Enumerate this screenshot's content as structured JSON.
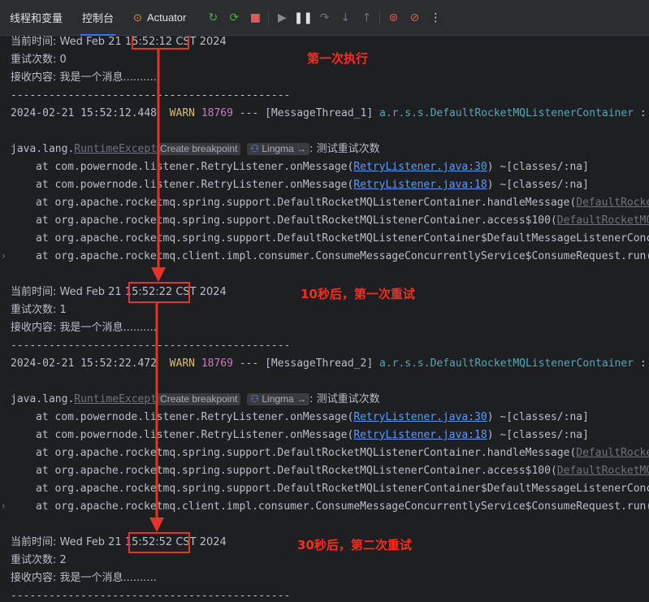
{
  "toolbar": {
    "tabs": [
      "线程和变量",
      "控制台",
      "Actuator"
    ],
    "more": "⋮"
  },
  "blocks": [
    {
      "time_prefix": "当前时间: Wed Feb 21 ",
      "time": "15:52:12",
      "time_suffix": " CST 2024",
      "retry": "重试次数: 0",
      "content": "接收内容: 我是一个消息..........",
      "divider": "--------------------------------------------",
      "log_ts": "2024-02-21 15:52:12.448",
      "log_level": "WARN",
      "log_pid": "18769",
      "log_thread": " --- [MessageThread_1] ",
      "log_class": "a.r.s.s.DefaultRocketMQListenerContainer",
      "log_tail": " :",
      "annotation": "第一次执行"
    },
    {
      "time_prefix": "当前时间: Wed Feb 21 ",
      "time": "15:52:22",
      "time_suffix": " CST 2024",
      "retry": "重试次数: 1",
      "content": "接收内容: 我是一个消息..........",
      "divider": "--------------------------------------------",
      "log_ts": "2024-02-21 15:52:22.472",
      "log_level": "WARN",
      "log_pid": "18769",
      "log_thread": " --- [MessageThread_2] ",
      "log_class": "a.r.s.s.DefaultRocketMQListenerContainer",
      "log_tail": " :",
      "annotation": "10秒后，第一次重试"
    },
    {
      "time_prefix": "当前时间: Wed Feb 21 ",
      "time": "15:52:52",
      "time_suffix": " CST 2024",
      "retry": "重试次数: 2",
      "content": "接收内容: 我是一个消息..........",
      "divider": "--------------------------------------------",
      "annotation": "30秒后，第二次重试"
    }
  ],
  "exception": {
    "prefix": "java.lang.",
    "name": "RuntimeExcept",
    "create_breakpoint": "Create breakpoint",
    "lingma": "Lingma",
    "message": ": 测试重试次数",
    "stack": [
      {
        "text": "at com.powernode.listener.RetryListener.onMessage(",
        "link": "RetryListener.java:30",
        "tail": ") ~[classes/:na]",
        "gray": false
      },
      {
        "text": "at com.powernode.listener.RetryListener.onMessage(",
        "link": "RetryListener.java:18",
        "tail": ") ~[classes/:na]",
        "gray": false
      },
      {
        "text": "at org.apache.rocketmq.spring.support.DefaultRocketMQListenerContainer.handleMessage(",
        "link": "DefaultRocke",
        "tail": "",
        "gray": true
      },
      {
        "text": "at org.apache.rocketmq.spring.support.DefaultRocketMQListenerContainer.access$100(",
        "link": "DefaultRocketMQ",
        "tail": "",
        "gray": true
      },
      {
        "text": "at org.apache.rocketmq.spring.support.DefaultRocketMQListenerContainer$DefaultMessageListenerConc",
        "link": "",
        "tail": "",
        "gray": true
      },
      {
        "text": "at org.apache.rocketmq.client.impl.consumer.ConsumeMessageConcurrentlyService$ConsumeRequest.run(",
        "link": "",
        "tail": "",
        "gray": true
      }
    ]
  },
  "colors": {
    "background": "#1e1f22",
    "toolbar": "#2b2d30",
    "text": "#bcbec4",
    "warn": "#e0bb65",
    "pid": "#c77dbb",
    "logger": "#56a8b3",
    "link": "#5e9af5",
    "annotation": "#ff2b1c"
  }
}
